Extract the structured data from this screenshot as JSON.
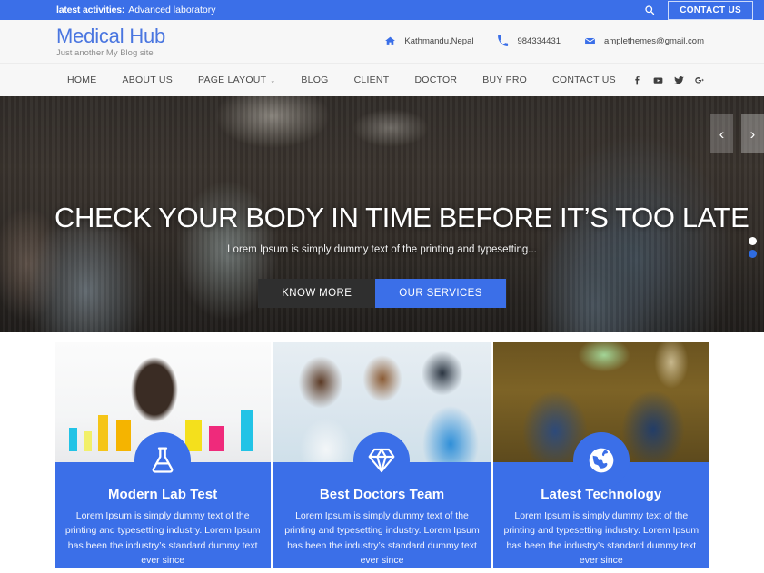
{
  "topbar": {
    "label": "latest activities:",
    "text": "Advanced laboratory",
    "search_icon": "search-icon",
    "contact_button": "CONTACT US"
  },
  "header": {
    "brand_title": "Medical Hub",
    "brand_tagline": "Just another My Blog site",
    "contacts": [
      {
        "icon": "home-icon",
        "text": "Kathmandu,Nepal"
      },
      {
        "icon": "phone-icon",
        "text": "984334431"
      },
      {
        "icon": "envelope-icon",
        "text": "amplethemes@gmail.com"
      }
    ]
  },
  "nav": {
    "items": [
      {
        "label": "HOME",
        "has_dropdown": false
      },
      {
        "label": "ABOUT US",
        "has_dropdown": false
      },
      {
        "label": "PAGE LAYOUT",
        "has_dropdown": true
      },
      {
        "label": "BLOG",
        "has_dropdown": false
      },
      {
        "label": "CLIENT",
        "has_dropdown": false
      },
      {
        "label": "DOCTOR",
        "has_dropdown": false
      },
      {
        "label": "BUY PRO",
        "has_dropdown": false
      },
      {
        "label": "CONTACT US",
        "has_dropdown": false
      }
    ],
    "social": [
      "facebook-icon",
      "youtube-icon",
      "twitter-icon",
      "google-plus-icon"
    ],
    "caret": "⌄"
  },
  "hero": {
    "title": "CHECK YOUR BODY IN TIME BEFORE IT’S TOO LATE",
    "subtitle": "Lorem Ipsum is simply dummy text of the printing and typesetting...",
    "button_primary": "KNOW MORE",
    "button_secondary": "OUR SERVICES",
    "arrow_prev": "‹",
    "arrow_next": "›",
    "dots": [
      {
        "state": "active"
      },
      {
        "state": "inactive"
      }
    ]
  },
  "cards": [
    {
      "icon": "flask-icon",
      "title": "Modern Lab Test",
      "text": "Lorem Ipsum is simply dummy text of the printing and typesetting industry. Lorem Ipsum has been the industry’s standard dummy text ever since"
    },
    {
      "icon": "diamond-icon",
      "title": "Best Doctors Team",
      "text": "Lorem Ipsum is simply dummy text of the printing and typesetting industry. Lorem Ipsum has been the industry’s standard dummy text ever since"
    },
    {
      "icon": "globe-icon",
      "title": "Latest Technology",
      "text": "Lorem Ipsum is simply dummy text of the printing and typesetting industry. Lorem Ipsum has been the industry’s standard dummy text ever since"
    }
  ],
  "colors": {
    "brand_blue": "#3b6fe8",
    "header_bg": "#f7f7f7",
    "dark_button": "#2f2f2f"
  }
}
